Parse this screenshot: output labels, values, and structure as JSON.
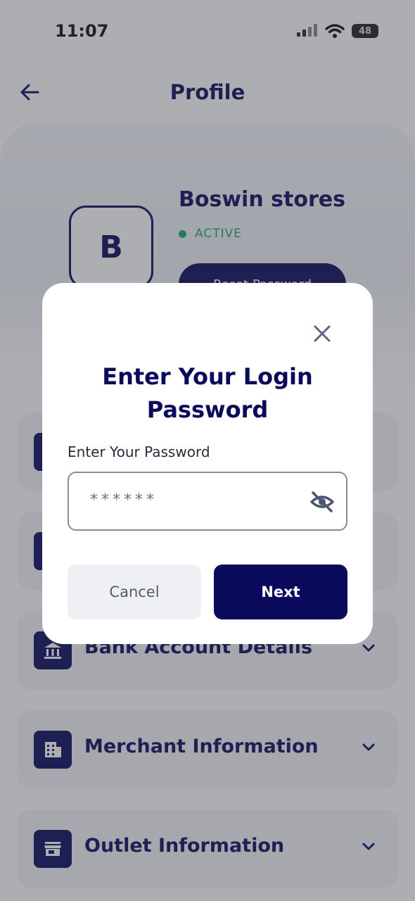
{
  "status_bar": {
    "time": "11:07",
    "battery": "48"
  },
  "header": {
    "title": "Profile"
  },
  "profile": {
    "avatar_letter": "B",
    "store_name": "Boswin stores",
    "status": "ACTIVE",
    "reset_button": "Reset Password"
  },
  "sections": [
    {
      "label": "Bank Account Details",
      "icon": "bank-icon"
    },
    {
      "label": "Merchant Information",
      "icon": "building-icon"
    },
    {
      "label": "Outlet Information",
      "icon": "store-icon"
    }
  ],
  "modal": {
    "title_line1": "Enter Your Login",
    "title_line2": "Password",
    "field_label": "Enter Your Password",
    "password_value": "******",
    "cancel_label": "Cancel",
    "next_label": "Next"
  },
  "colors": {
    "primary": "#0a0a5c",
    "active_green": "#1aa864",
    "cancel_bg": "#eef0f4"
  }
}
